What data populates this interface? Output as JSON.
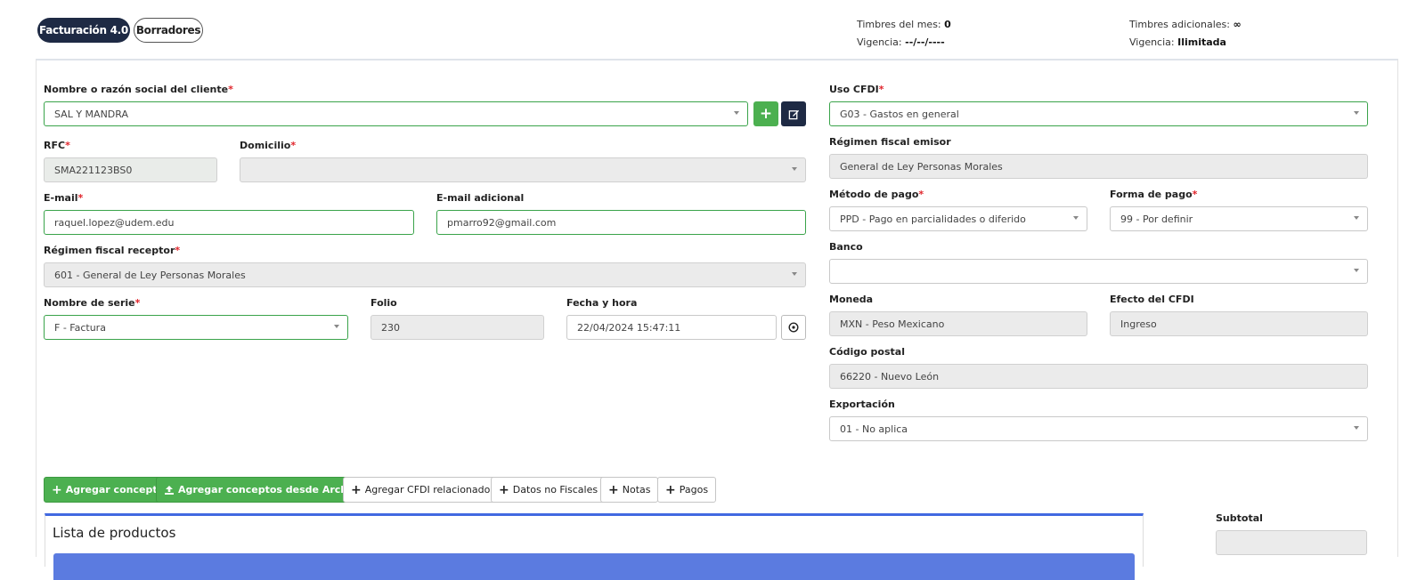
{
  "tabs": [
    {
      "label": "Facturación 4.0"
    },
    {
      "label": "Borradores"
    }
  ],
  "stamps": {
    "mes_label": "Timbres del mes:",
    "mes_value": "0",
    "vigencia1_label": "Vigencia:",
    "vigencia1_value": "--/--/----",
    "adic_label": "Timbres adicionales:",
    "adic_value": "∞",
    "vigencia2_label": "Vigencia:",
    "vigencia2_value": "Ilimitada"
  },
  "left": {
    "cliente_label": "Nombre o razón social del cliente",
    "cliente_value": "SAL Y MANDRA",
    "rfc_label": "RFC",
    "rfc_value": "SMA221123BS0",
    "domicilio_label": "Domicilio",
    "domicilio_value": "",
    "email_label": "E-mail",
    "email_value": "raquel.lopez@udem.edu",
    "email_adicional_label": "E-mail adicional",
    "email_adicional_value": "pmarro92@gmail.com",
    "regimen_receptor_label": "Régimen fiscal receptor",
    "regimen_receptor_value": "601 - General de Ley Personas Morales",
    "serie_label": "Nombre de serie",
    "serie_value": "F - Factura",
    "folio_label": "Folio",
    "folio_value": "230",
    "fecha_label": "Fecha y hora",
    "fecha_value": "22/04/2024 15:47:11"
  },
  "right": {
    "uso_label": "Uso CFDI",
    "uso_value": "G03 - Gastos en general",
    "regimen_emisor_label": "Régimen fiscal emisor",
    "regimen_emisor_value": "General de Ley Personas Morales",
    "metodo_label": "Método de pago",
    "metodo_value": "PPD - Pago en parcialidades o diferido",
    "forma_label": "Forma de pago",
    "forma_value": "99 - Por definir",
    "banco_label": "Banco",
    "banco_value": "",
    "moneda_label": "Moneda",
    "moneda_value": "MXN - Peso Mexicano",
    "efecto_label": "Efecto del CFDI",
    "efecto_value": "Ingreso",
    "cp_label": "Código postal",
    "cp_value": "66220 - Nuevo León",
    "exportacion_label": "Exportación",
    "exportacion_value": "01 - No aplica"
  },
  "required_mark": "*",
  "actions": [
    {
      "label": "Agregar concepto"
    },
    {
      "label": "Agregar conceptos desde Archivo"
    },
    {
      "label": "Agregar CFDI relacionado"
    },
    {
      "label": "Datos no Fiscales"
    },
    {
      "label": "Notas"
    },
    {
      "label": "Pagos"
    }
  ],
  "productos": {
    "title": "Lista de productos"
  },
  "totales": {
    "subtotal_label": "Subtotal",
    "subtotal_value": ""
  },
  "colors": {
    "navy": "#1e2a44",
    "green": "#4cb050",
    "blue": "#5b7be0",
    "required": "#e0242b"
  }
}
